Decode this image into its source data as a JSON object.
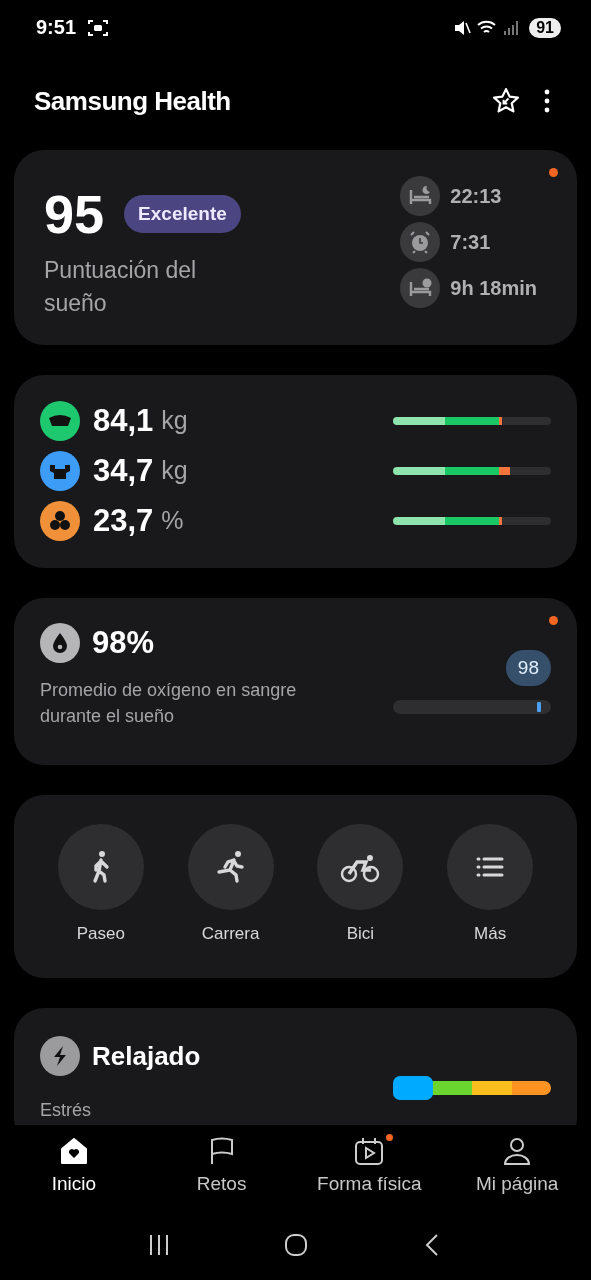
{
  "status_bar": {
    "time": "9:51",
    "battery": "91"
  },
  "header": {
    "title": "Samsung Health"
  },
  "sleep": {
    "score": "95",
    "rating": "Excelente",
    "label": "Puntuación del sueño",
    "alert": true,
    "times": [
      {
        "kind": "bedtime",
        "value": "22:13"
      },
      {
        "kind": "wake",
        "value": "7:31"
      },
      {
        "kind": "duration",
        "value": "9h 18min"
      }
    ]
  },
  "body": [
    {
      "kind": "weight",
      "value": "84,1",
      "unit": "kg"
    },
    {
      "kind": "muscle",
      "value": "34,7",
      "unit": "kg"
    },
    {
      "kind": "fat",
      "value": "23,7",
      "unit": "%"
    }
  ],
  "oxygen": {
    "value": "98%",
    "label": "Promedio de oxígeno en sangre durante el sueño",
    "badge": "98",
    "level": 0.91,
    "alert": true
  },
  "workouts": [
    {
      "kind": "walk",
      "label": "Paseo"
    },
    {
      "kind": "run",
      "label": "Carrera"
    },
    {
      "kind": "bike",
      "label": "Bici"
    },
    {
      "kind": "more",
      "label": "Más"
    }
  ],
  "stress": {
    "status": "Relajado",
    "label": "Estrés"
  },
  "nav": [
    {
      "kind": "home",
      "label": "Inicio",
      "selected": true,
      "badge": false
    },
    {
      "kind": "flag",
      "label": "Retos",
      "selected": false,
      "badge": false
    },
    {
      "kind": "fitness",
      "label": "Forma física",
      "selected": false,
      "badge": true
    },
    {
      "kind": "profile",
      "label": "Mi página",
      "selected": false,
      "badge": false
    }
  ]
}
